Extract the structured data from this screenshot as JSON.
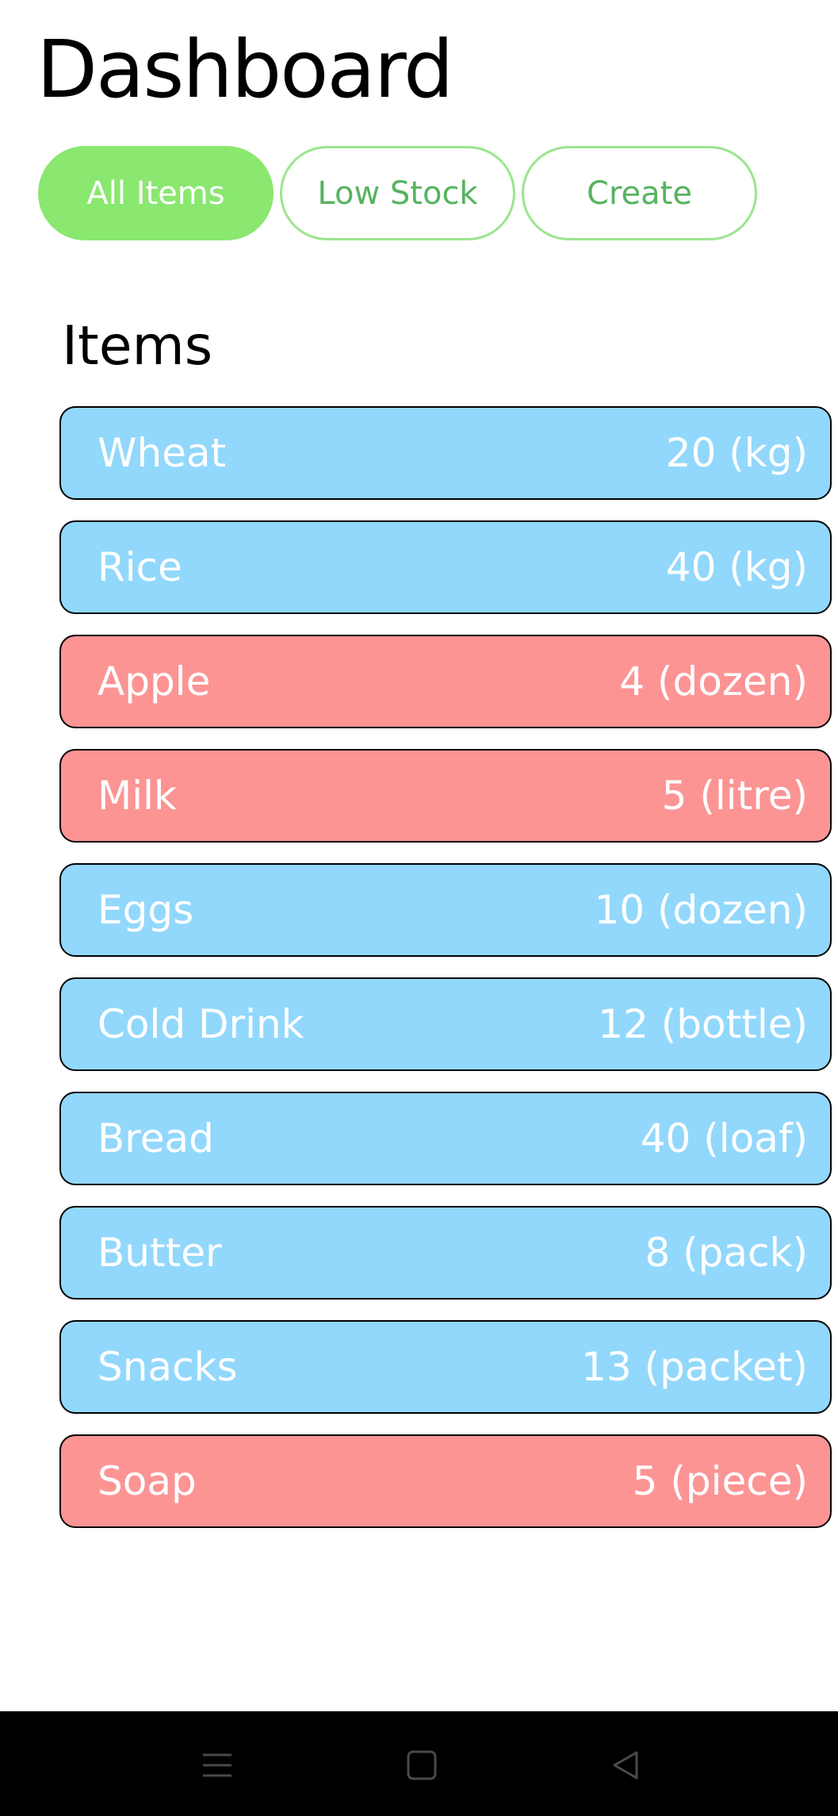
{
  "header": {
    "title": "Dashboard"
  },
  "tabs": [
    {
      "label": "All Items",
      "active": true
    },
    {
      "label": "Low Stock",
      "active": false
    },
    {
      "label": "Create",
      "active": false
    }
  ],
  "items_section": {
    "heading": "Items",
    "items": [
      {
        "name": "Wheat",
        "quantity": "20 (kg)",
        "status": "normal"
      },
      {
        "name": "Rice",
        "quantity": "40 (kg)",
        "status": "normal"
      },
      {
        "name": "Apple",
        "quantity": "4 (dozen)",
        "status": "low"
      },
      {
        "name": "Milk",
        "quantity": "5 (litre)",
        "status": "low"
      },
      {
        "name": "Eggs",
        "quantity": "10 (dozen)",
        "status": "normal"
      },
      {
        "name": "Cold Drink",
        "quantity": "12 (bottle)",
        "status": "normal"
      },
      {
        "name": "Bread",
        "quantity": "40 (loaf)",
        "status": "normal"
      },
      {
        "name": "Butter",
        "quantity": "8 (pack)",
        "status": "normal"
      },
      {
        "name": "Snacks",
        "quantity": "13 (packet)",
        "status": "normal"
      },
      {
        "name": "Soap",
        "quantity": "5 (piece)",
        "status": "low"
      }
    ]
  },
  "colors": {
    "accent": "#8ae76f",
    "tab_text": "#56b35f",
    "normal_item": "#92d8fc",
    "low_item": "#fc9494"
  },
  "nav": {
    "icons": [
      "menu-icon",
      "home-icon",
      "back-icon"
    ]
  }
}
